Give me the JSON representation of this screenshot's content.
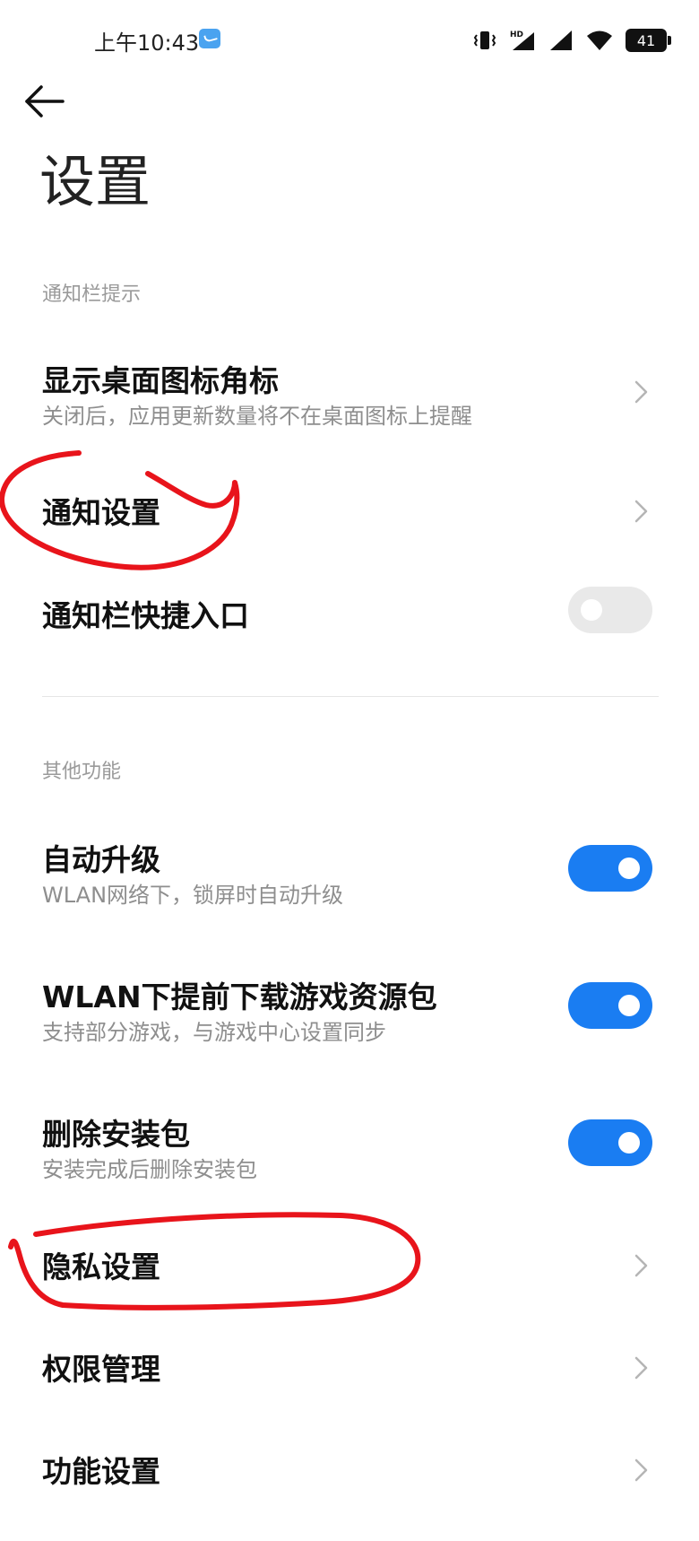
{
  "status_bar": {
    "time": "上午10:43",
    "battery_level": "41"
  },
  "header": {
    "title": "设置"
  },
  "sections": [
    {
      "title": "通知栏提示",
      "items": [
        {
          "title": "显示桌面图标角标",
          "subtitle": "关闭后，应用更新数量将不在桌面图标上提醒",
          "control": "chevron"
        },
        {
          "title": "通知设置",
          "control": "chevron"
        },
        {
          "title": "通知栏快捷入口",
          "control": "toggle",
          "on": false
        }
      ]
    },
    {
      "title": "其他功能",
      "items": [
        {
          "title": "自动升级",
          "subtitle": "WLAN网络下，锁屏时自动升级",
          "control": "toggle",
          "on": true
        },
        {
          "title": "WLAN下提前下载游戏资源包",
          "subtitle": "支持部分游戏，与游戏中心设置同步",
          "control": "toggle",
          "on": true
        },
        {
          "title": "删除安装包",
          "subtitle": "安装完成后删除安装包",
          "control": "toggle",
          "on": true
        },
        {
          "title": "隐私设置",
          "control": "chevron"
        },
        {
          "title": "权限管理",
          "control": "chevron"
        },
        {
          "title": "功能设置",
          "control": "chevron"
        }
      ]
    }
  ],
  "colors": {
    "accent": "#1a7df2",
    "annotation": "#e8141b"
  }
}
